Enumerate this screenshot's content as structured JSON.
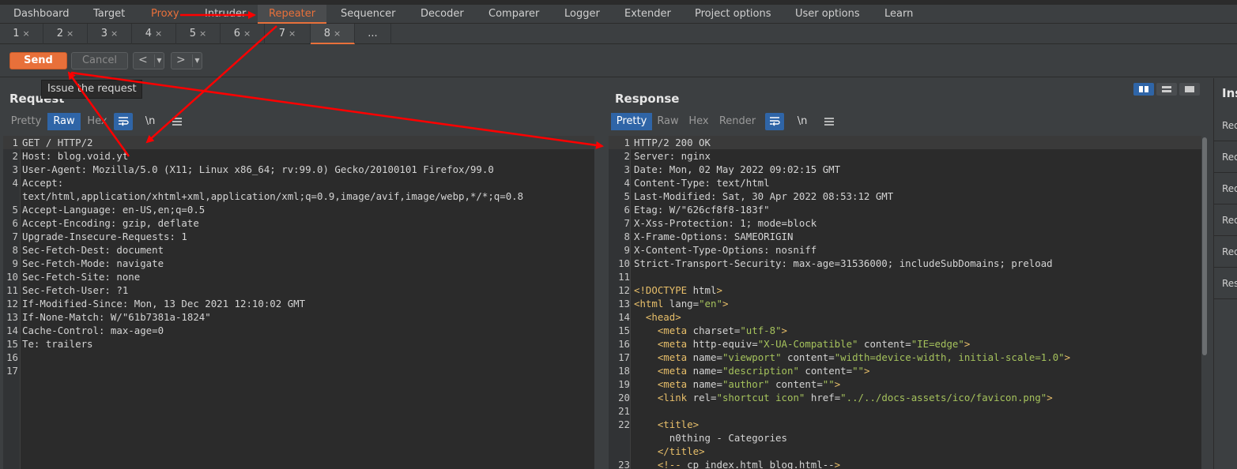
{
  "main_tabs": [
    {
      "label": "Dashboard"
    },
    {
      "label": "Target"
    },
    {
      "label": "Proxy"
    },
    {
      "label": "Intruder"
    },
    {
      "label": "Repeater"
    },
    {
      "label": "Sequencer"
    },
    {
      "label": "Decoder"
    },
    {
      "label": "Comparer"
    },
    {
      "label": "Logger"
    },
    {
      "label": "Extender"
    },
    {
      "label": "Project options"
    },
    {
      "label": "User options"
    },
    {
      "label": "Learn"
    }
  ],
  "repeater_tabs": [
    {
      "label": "1"
    },
    {
      "label": "2"
    },
    {
      "label": "3"
    },
    {
      "label": "4"
    },
    {
      "label": "5"
    },
    {
      "label": "6"
    },
    {
      "label": "7"
    },
    {
      "label": "8"
    }
  ],
  "more_tabs_label": "...",
  "close_glyph": "×",
  "toolbar": {
    "send_label": "Send",
    "cancel_label": "Cancel",
    "back_glyph": "<",
    "forward_glyph": ">",
    "dropdown_glyph": "▼"
  },
  "tooltip": "Issue the request",
  "request": {
    "title": "Request",
    "view_tabs": [
      "Pretty",
      "Raw",
      "Hex"
    ],
    "active_view": "Raw",
    "newline_label": "\\n",
    "lines": [
      "GET / HTTP/2",
      "Host: blog.void.yt",
      "User-Agent: Mozilla/5.0 (X11; Linux x86_64; rv:99.0) Gecko/20100101 Firefox/99.0",
      "Accept:",
      "text/html,application/xhtml+xml,application/xml;q=0.9,image/avif,image/webp,*/*;q=0.8",
      "Accept-Language: en-US,en;q=0.5",
      "Accept-Encoding: gzip, deflate",
      "Upgrade-Insecure-Requests: 1",
      "Sec-Fetch-Dest: document",
      "Sec-Fetch-Mode: navigate",
      "Sec-Fetch-Site: none",
      "Sec-Fetch-User: ?1",
      "If-Modified-Since: Mon, 13 Dec 2021 12:10:02 GMT",
      "If-None-Match: W/\"61b7381a-1824\"",
      "Cache-Control: max-age=0",
      "Te: trailers",
      "",
      ""
    ],
    "line_numbers": [
      "1",
      "2",
      "3",
      "4",
      "",
      "5",
      "6",
      "7",
      "8",
      "9",
      "10",
      "11",
      "12",
      "13",
      "14",
      "15",
      "16",
      "17"
    ]
  },
  "response": {
    "title": "Response",
    "view_tabs": [
      "Pretty",
      "Raw",
      "Hex",
      "Render"
    ],
    "active_view": "Pretty",
    "newline_label": "\\n",
    "lines": [
      "HTTP/2 200 OK",
      "Server: nginx",
      "Date: Mon, 02 May 2022 09:02:15 GMT",
      "Content-Type: text/html",
      "Last-Modified: Sat, 30 Apr 2022 08:53:12 GMT",
      "Etag: W/\"626cf8f8-183f\"",
      "X-Xss-Protection: 1; mode=block",
      "X-Frame-Options: SAMEORIGIN",
      "X-Content-Type-Options: nosniff",
      "Strict-Transport-Security: max-age=31536000; includeSubDomains; preload",
      "",
      "<!DOCTYPE html>",
      "<html lang=\"en\">",
      "  <head>",
      "    <meta charset=\"utf-8\">",
      "    <meta http-equiv=\"X-UA-Compatible\" content=\"IE=edge\">",
      "    <meta name=\"viewport\" content=\"width=device-width, initial-scale=1.0\">",
      "    <meta name=\"description\" content=\"\">",
      "    <meta name=\"author\" content=\"\">",
      "    <link rel=\"shortcut icon\" href=\"../../docs-assets/ico/favicon.png\">",
      "",
      "    <title>",
      "      n0thing - Categories",
      "    </title>",
      "    <!-- cp index.html blog.html-->"
    ],
    "line_numbers": [
      "1",
      "2",
      "3",
      "4",
      "5",
      "6",
      "7",
      "8",
      "9",
      "10",
      "11",
      "12",
      "13",
      "14",
      "15",
      "16",
      "17",
      "18",
      "19",
      "20",
      "21",
      "22",
      "",
      "",
      "23"
    ]
  },
  "inspector": {
    "title": "Ins",
    "items": [
      "Req",
      "Req",
      "Req",
      "Req",
      "Req",
      "Res"
    ]
  },
  "colors": {
    "accent": "#e8703a",
    "active_view": "#2f65a7",
    "annotation_arrow": "#ff0000"
  },
  "icons": [
    "wrap-lines-icon",
    "show-newlines-icon",
    "menu-icon",
    "layout-split-icon",
    "layout-horizontal-icon",
    "layout-single-icon"
  ]
}
